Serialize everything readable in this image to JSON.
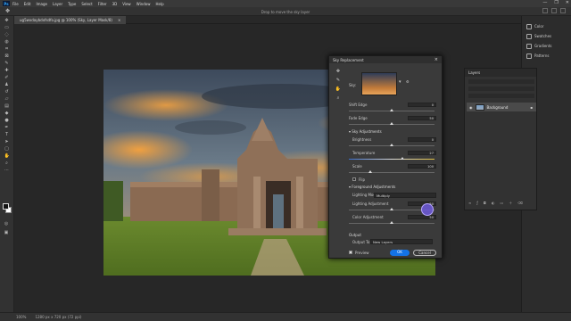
{
  "app": {
    "logo": "Ps",
    "menu": [
      "File",
      "Edit",
      "Image",
      "Layer",
      "Type",
      "Select",
      "Filter",
      "3D",
      "View",
      "Window",
      "Help"
    ],
    "window_controls": [
      "—",
      "❐",
      "✕"
    ]
  },
  "options_bar": {
    "hint": "Drop to move the sky layer"
  },
  "document_tab": {
    "title": "ug5wxdaybdxfsdfo.jpg @ 100% (Sky, Layer Mask/8)",
    "close": "×"
  },
  "status_bar": {
    "zoom": "100%",
    "info": "1280 px x 720 px (72 ppi)"
  },
  "right_strip": {
    "items": [
      {
        "label": "Color",
        "icon": "color-icon"
      },
      {
        "label": "Swatches",
        "icon": "swatches-icon"
      },
      {
        "label": "Gradients",
        "icon": "gradients-icon"
      },
      {
        "label": "Patterns",
        "icon": "patterns-icon"
      }
    ]
  },
  "layers_panel": {
    "title": "Layers",
    "layer_name": "Background"
  },
  "sky_dialog": {
    "title": "Sky Replacement",
    "close": "×",
    "sky_label": "Sky:",
    "shift_edge": {
      "label": "Shift Edge",
      "value": "0",
      "level": 0.5
    },
    "fade_edge": {
      "label": "Fade Edge",
      "value": "50",
      "level": 0.5
    },
    "sky_adjustments": "Sky Adjustments",
    "brightness": {
      "label": "Brightness",
      "value": "0",
      "level": 0.5
    },
    "temperature": {
      "label": "Temperature",
      "value": "27",
      "level": 0.62
    },
    "scale": {
      "label": "Scale",
      "value": "100",
      "level": 0.25
    },
    "flip": "Flip",
    "foreground_adjustments": "Foreground Adjustments",
    "lighting_mode": {
      "label": "Lighting Mode:",
      "value": "Multiply"
    },
    "lighting_adjustment": {
      "label": "Lighting Adjustment",
      "value": "50",
      "level": 0.5
    },
    "color_adjustment": {
      "label": "Color Adjustment",
      "value": "50",
      "level": 0.5
    },
    "output": "Output",
    "output_to": {
      "label": "Output To:",
      "value": "New Layers"
    },
    "preview": "Preview",
    "ok": "OK",
    "cancel": "Cancel"
  },
  "colors": {
    "accent": "#31a8ff",
    "ok_button": "#1473e6",
    "cursor": "#6e5adc"
  }
}
